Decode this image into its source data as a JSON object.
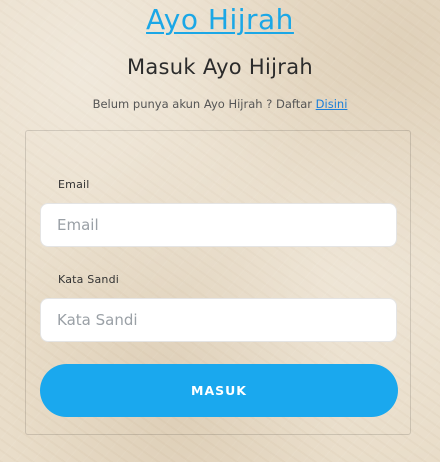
{
  "brand": {
    "title": "Ayo Hijrah",
    "color": "#1ba7e6"
  },
  "page": {
    "heading": "Masuk Ayo Hijrah",
    "register_prompt": "Belum punya akun Ayo Hijrah ? Daftar",
    "register_link_label": "Disini"
  },
  "form": {
    "email": {
      "label": "Email",
      "placeholder": "Email",
      "value": ""
    },
    "password": {
      "label": "Kata Sandi",
      "placeholder": "Kata Sandi",
      "value": ""
    },
    "submit_label": "MASUK",
    "submit_color": "#1aa8ee"
  }
}
